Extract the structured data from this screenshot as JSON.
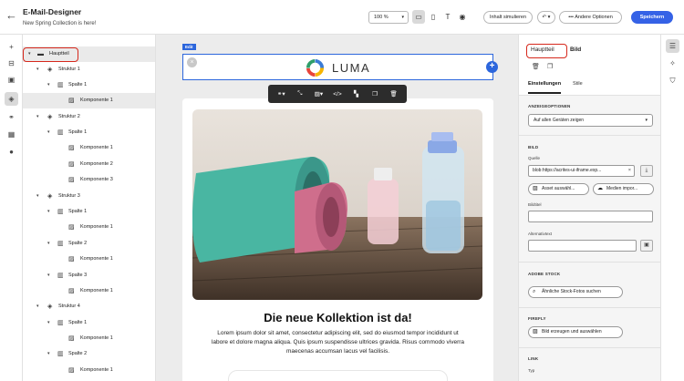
{
  "header": {
    "title": "E-Mail-Designer",
    "subtitle": "New Spring Collection is here!",
    "zoom": "100 %",
    "simulate_label": "Inhalt simulieren",
    "more_options_label": "Andere Optionen",
    "save_label": "Speichern"
  },
  "tree": {
    "rows": [
      {
        "label": "Hauptteil",
        "level": 0,
        "type": "folder"
      },
      {
        "label": "Struktur 1",
        "level": 1,
        "type": "structure"
      },
      {
        "label": "Spalte 1",
        "level": 2,
        "type": "column"
      },
      {
        "label": "Komponente 1",
        "level": 3,
        "type": "component"
      },
      {
        "label": "Struktur 2",
        "level": 1,
        "type": "structure"
      },
      {
        "label": "Spalte 1",
        "level": 2,
        "type": "column"
      },
      {
        "label": "Komponente 1",
        "level": 3,
        "type": "component"
      },
      {
        "label": "Komponente 2",
        "level": 3,
        "type": "component"
      },
      {
        "label": "Komponente 3",
        "level": 3,
        "type": "component"
      },
      {
        "label": "Struktur 3",
        "level": 1,
        "type": "structure"
      },
      {
        "label": "Spalte 1",
        "level": 2,
        "type": "column"
      },
      {
        "label": "Komponente 1",
        "level": 3,
        "type": "component"
      },
      {
        "label": "Spalte 2",
        "level": 2,
        "type": "column"
      },
      {
        "label": "Komponente 1",
        "level": 3,
        "type": "component"
      },
      {
        "label": "Spalte 3",
        "level": 2,
        "type": "column"
      },
      {
        "label": "Komponente 1",
        "level": 3,
        "type": "component"
      },
      {
        "label": "Struktur 4",
        "level": 1,
        "type": "structure"
      },
      {
        "label": "Spalte 1",
        "level": 2,
        "type": "column"
      },
      {
        "label": "Komponente 1",
        "level": 3,
        "type": "component"
      },
      {
        "label": "Spalte 2",
        "level": 2,
        "type": "column"
      },
      {
        "label": "Komponente 1",
        "level": 3,
        "type": "component"
      }
    ]
  },
  "canvas": {
    "edit_tag": "Edit",
    "logo_text": "LUMA",
    "headline": "Die neue Kollektion ist da!",
    "body": "Lorem ipsum dolor sit amet, consectetur adipiscing elit, sed do eiusmod tempor incididunt ut labore et dolore magna aliqua. Quis ipsum suspendisse ultrices gravida. Risus commodo viverra maecenas accumsan lacus vel facilisis."
  },
  "props": {
    "crumb_parent": "Hauptteil",
    "crumb_current": "Bild",
    "tab_settings": "Einstellungen",
    "tab_styles": "Stile",
    "display_section": "ANZEIGEOPTIONEN",
    "display_value": "Auf allen Geräten zeigen",
    "image_section": "BILD",
    "source_label": "Quelle",
    "source_value": "blob:https://acrites-ui-iframe.exp...",
    "asset_btn": "Asset auswähl...",
    "media_btn": "Medien impor...",
    "image_title_label": "Bildtitel",
    "alt_label": "Alternativtext",
    "stock_section": "ADOBE STOCK",
    "stock_btn": "Ähnliche Stock-Fotos suchen",
    "firefly_section": "FIREFLY",
    "firefly_btn": "Bild erzeugen und auswählen",
    "link_section": "LINK",
    "link_type_label": "Typ"
  },
  "colors": {
    "accent": "#3562e6",
    "highlight": "#d6281c",
    "selection": "#2c66dc"
  }
}
